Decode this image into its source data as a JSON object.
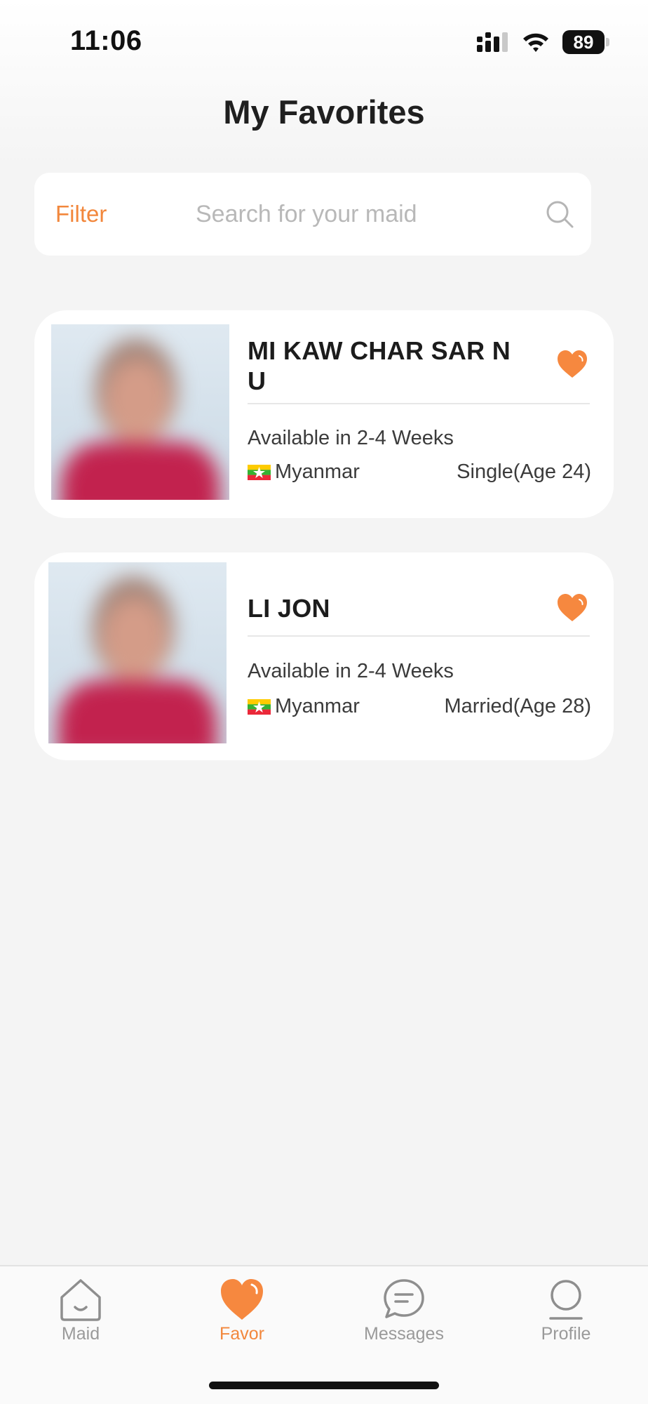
{
  "status_bar": {
    "time": "11:06",
    "battery": "89"
  },
  "header": {
    "title": "My Favorites"
  },
  "search": {
    "filter_label": "Filter",
    "placeholder": "Search for your maid"
  },
  "favorites": [
    {
      "name": "MI KAW CHAR SAR N U",
      "availability": "Available in 2-4 Weeks",
      "country": "Myanmar",
      "status": "Single(Age 24)"
    },
    {
      "name": "LI JON",
      "availability": "Available in 2-4 Weeks",
      "country": "Myanmar",
      "status": "Married(Age 28)"
    }
  ],
  "tabs": [
    {
      "label": "Maid",
      "icon": "home-icon",
      "active": false
    },
    {
      "label": "Favor",
      "icon": "heart-icon",
      "active": true
    },
    {
      "label": "Messages",
      "icon": "chat-icon",
      "active": false
    },
    {
      "label": "Profile",
      "icon": "profile-icon",
      "active": false
    }
  ],
  "colors": {
    "accent": "#f2873c",
    "background": "#f4f4f4"
  }
}
